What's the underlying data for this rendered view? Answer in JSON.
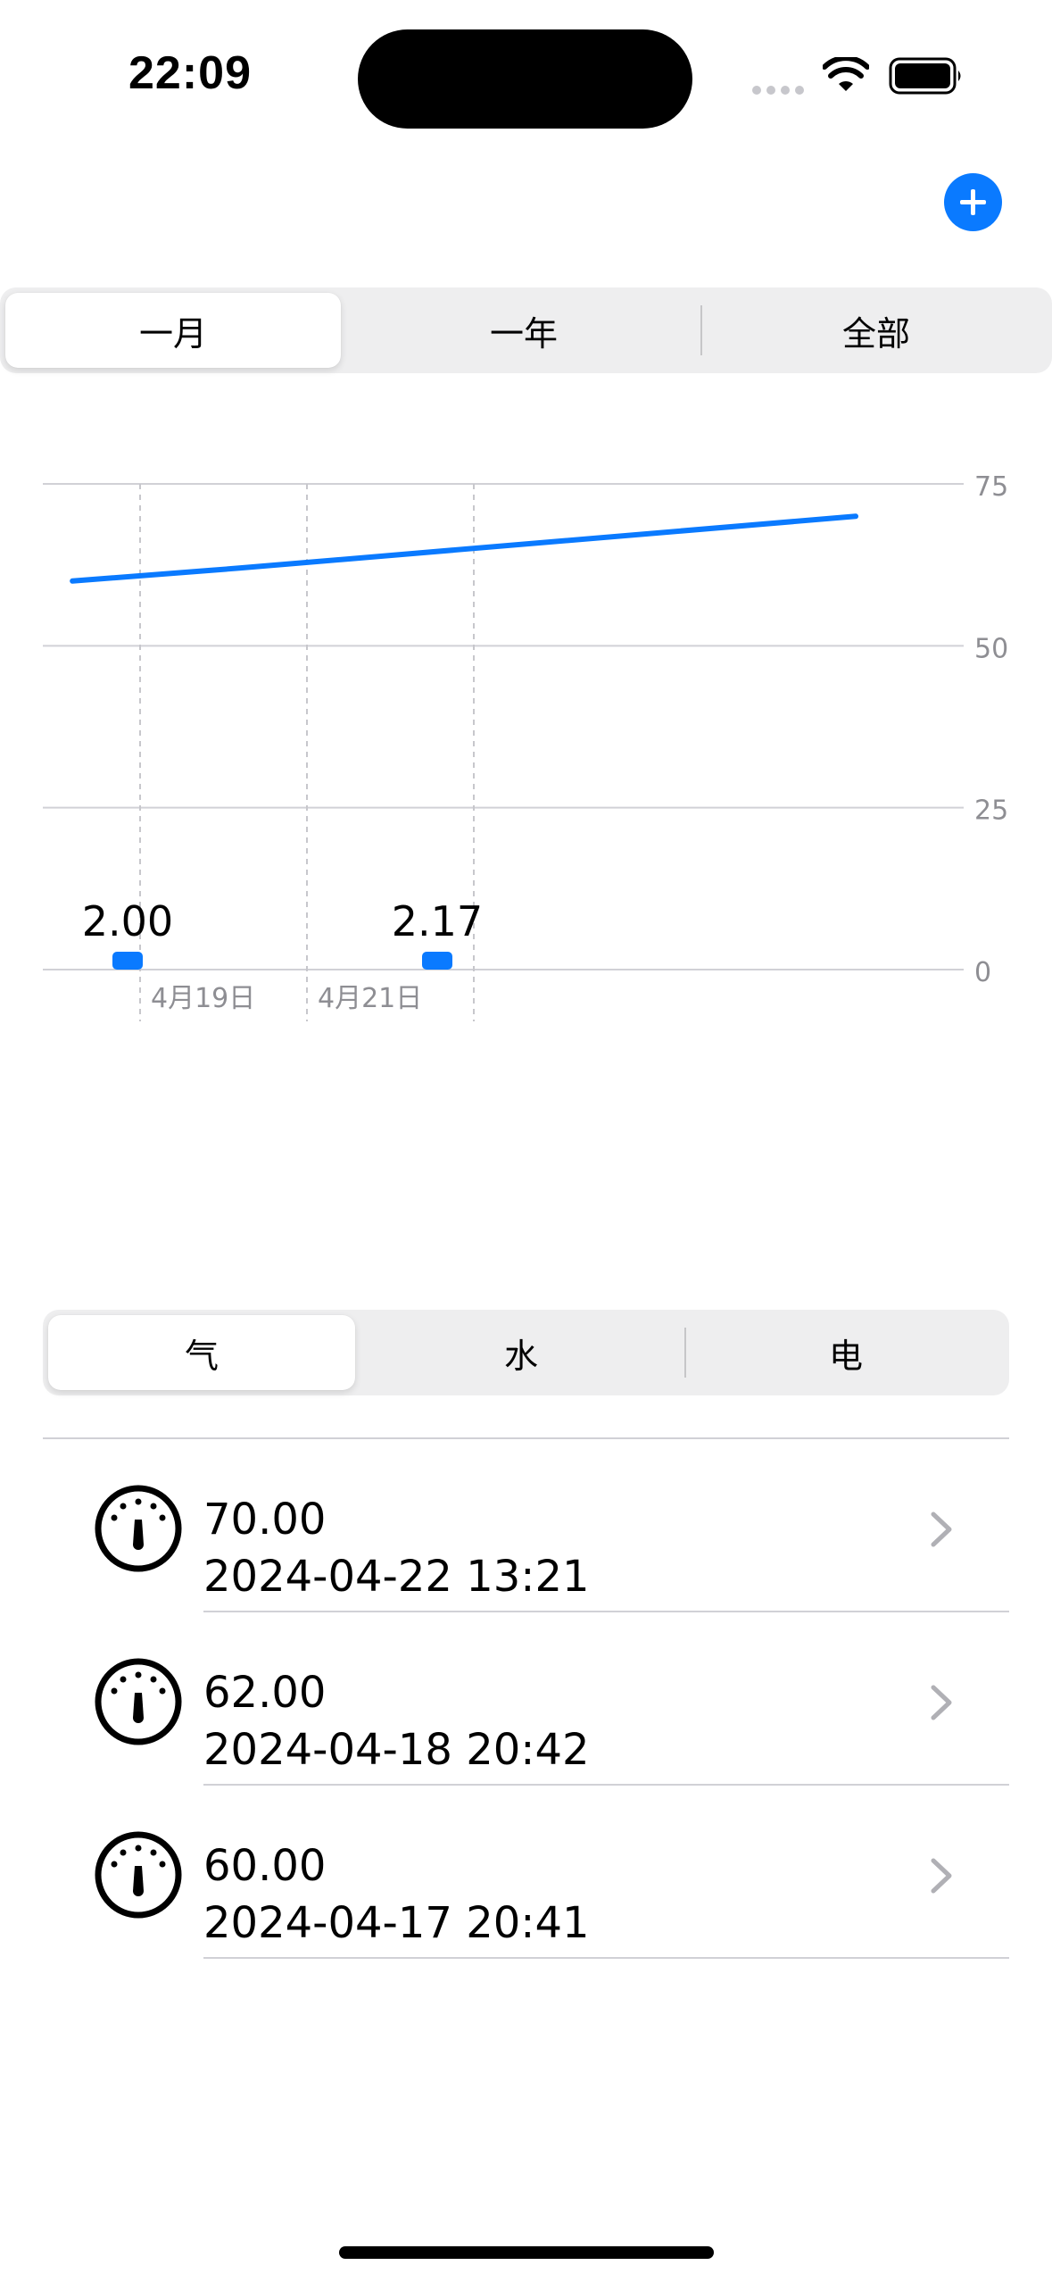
{
  "status_bar": {
    "time": "22:09"
  },
  "period_tabs": {
    "tabs": [
      "一月",
      "一年",
      "全部"
    ],
    "selected": 0
  },
  "chart_data": {
    "type": "line",
    "y_ticks": [
      "75",
      "50",
      "25",
      "0"
    ],
    "ylim": [
      0,
      75
    ],
    "x_tick_labels": [
      "4月19日",
      "4月21日"
    ],
    "series": [
      {
        "points": [
          {
            "x": "2024-04-17 20:41",
            "y": 60
          },
          {
            "x": "2024-04-18 20:42",
            "y": 62
          },
          {
            "x": "2024-04-22 13:21",
            "y": 70
          }
        ]
      }
    ],
    "bars": [
      {
        "label": "2.00",
        "y": 2.0
      },
      {
        "label": "2.17",
        "y": 2.17
      }
    ],
    "accent": "#0a7aff"
  },
  "utility_tabs": {
    "tabs": [
      "气",
      "水",
      "电"
    ],
    "selected": 0
  },
  "readings": [
    {
      "value": "70.00",
      "date": "2024-04-22 13:21",
      "icon": "gauge-icon"
    },
    {
      "value": "62.00",
      "date": "2024-04-18 20:42",
      "icon": "gauge-icon"
    },
    {
      "value": "60.00",
      "date": "2024-04-17 20:41",
      "icon": "gauge-icon"
    }
  ]
}
